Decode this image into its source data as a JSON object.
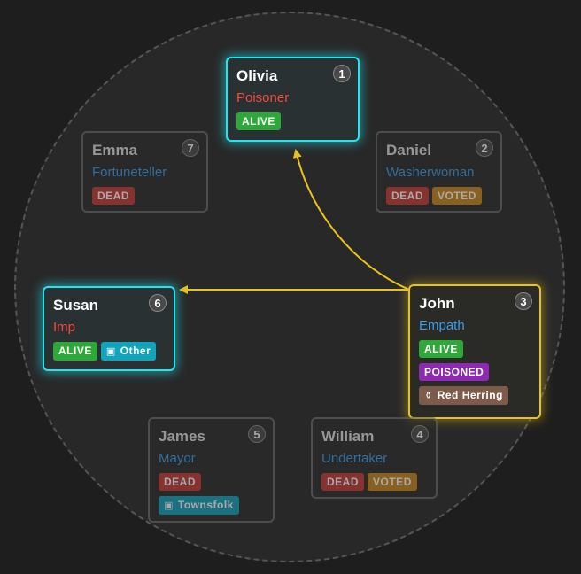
{
  "badge_text": {
    "alive": "ALIVE",
    "dead": "DEAD",
    "voted": "VOTED",
    "poisoned": "POISONED"
  },
  "reminder_icon": "treasure-chest-icon",
  "players": {
    "olivia": {
      "seat": "1",
      "name": "Olivia",
      "role": "Poisoner"
    },
    "daniel": {
      "seat": "2",
      "name": "Daniel",
      "role": "Washerwoman"
    },
    "john": {
      "seat": "3",
      "name": "John",
      "role": "Empath",
      "reminder": "Red Herring"
    },
    "william": {
      "seat": "4",
      "name": "William",
      "role": "Undertaker"
    },
    "james": {
      "seat": "5",
      "name": "James",
      "role": "Mayor",
      "reminder": "Townsfolk"
    },
    "susan": {
      "seat": "6",
      "name": "Susan",
      "role": "Imp",
      "reminder": "Other"
    },
    "emma": {
      "seat": "7",
      "name": "Emma",
      "role": "Fortuneteller"
    }
  },
  "colors": {
    "evil_role": "#ef4b3c",
    "good_role": "#3b9be8",
    "highlight_cyan": "#22e5f0",
    "highlight_gold": "#e9c21b",
    "arrow": "#e9c21b"
  }
}
